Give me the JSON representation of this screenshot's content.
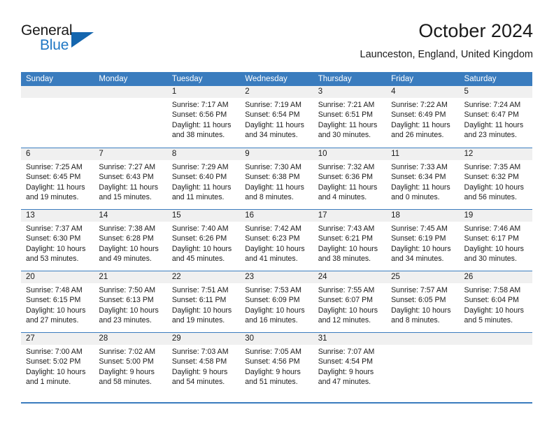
{
  "logo": {
    "word1": "General",
    "word2": "Blue",
    "accent_color": "#1566ae"
  },
  "header": {
    "title": "October 2024",
    "subtitle": "Launceston, England, United Kingdom"
  },
  "theme": {
    "header_blue": "#3a7cbe",
    "daynum_band": "#f0f0f0"
  },
  "weekdays": [
    "Sunday",
    "Monday",
    "Tuesday",
    "Wednesday",
    "Thursday",
    "Friday",
    "Saturday"
  ],
  "labels": {
    "sunrise": "Sunrise:",
    "sunset": "Sunset:",
    "daylight": "Daylight:"
  },
  "weeks": [
    [
      {
        "day": "",
        "sunrise": "",
        "sunset": "",
        "daylight1": "",
        "daylight2": ""
      },
      {
        "day": "",
        "sunrise": "",
        "sunset": "",
        "daylight1": "",
        "daylight2": ""
      },
      {
        "day": "1",
        "sunrise": "Sunrise: 7:17 AM",
        "sunset": "Sunset: 6:56 PM",
        "daylight1": "Daylight: 11 hours",
        "daylight2": "and 38 minutes."
      },
      {
        "day": "2",
        "sunrise": "Sunrise: 7:19 AM",
        "sunset": "Sunset: 6:54 PM",
        "daylight1": "Daylight: 11 hours",
        "daylight2": "and 34 minutes."
      },
      {
        "day": "3",
        "sunrise": "Sunrise: 7:21 AM",
        "sunset": "Sunset: 6:51 PM",
        "daylight1": "Daylight: 11 hours",
        "daylight2": "and 30 minutes."
      },
      {
        "day": "4",
        "sunrise": "Sunrise: 7:22 AM",
        "sunset": "Sunset: 6:49 PM",
        "daylight1": "Daylight: 11 hours",
        "daylight2": "and 26 minutes."
      },
      {
        "day": "5",
        "sunrise": "Sunrise: 7:24 AM",
        "sunset": "Sunset: 6:47 PM",
        "daylight1": "Daylight: 11 hours",
        "daylight2": "and 23 minutes."
      }
    ],
    [
      {
        "day": "6",
        "sunrise": "Sunrise: 7:25 AM",
        "sunset": "Sunset: 6:45 PM",
        "daylight1": "Daylight: 11 hours",
        "daylight2": "and 19 minutes."
      },
      {
        "day": "7",
        "sunrise": "Sunrise: 7:27 AM",
        "sunset": "Sunset: 6:43 PM",
        "daylight1": "Daylight: 11 hours",
        "daylight2": "and 15 minutes."
      },
      {
        "day": "8",
        "sunrise": "Sunrise: 7:29 AM",
        "sunset": "Sunset: 6:40 PM",
        "daylight1": "Daylight: 11 hours",
        "daylight2": "and 11 minutes."
      },
      {
        "day": "9",
        "sunrise": "Sunrise: 7:30 AM",
        "sunset": "Sunset: 6:38 PM",
        "daylight1": "Daylight: 11 hours",
        "daylight2": "and 8 minutes."
      },
      {
        "day": "10",
        "sunrise": "Sunrise: 7:32 AM",
        "sunset": "Sunset: 6:36 PM",
        "daylight1": "Daylight: 11 hours",
        "daylight2": "and 4 minutes."
      },
      {
        "day": "11",
        "sunrise": "Sunrise: 7:33 AM",
        "sunset": "Sunset: 6:34 PM",
        "daylight1": "Daylight: 11 hours",
        "daylight2": "and 0 minutes."
      },
      {
        "day": "12",
        "sunrise": "Sunrise: 7:35 AM",
        "sunset": "Sunset: 6:32 PM",
        "daylight1": "Daylight: 10 hours",
        "daylight2": "and 56 minutes."
      }
    ],
    [
      {
        "day": "13",
        "sunrise": "Sunrise: 7:37 AM",
        "sunset": "Sunset: 6:30 PM",
        "daylight1": "Daylight: 10 hours",
        "daylight2": "and 53 minutes."
      },
      {
        "day": "14",
        "sunrise": "Sunrise: 7:38 AM",
        "sunset": "Sunset: 6:28 PM",
        "daylight1": "Daylight: 10 hours",
        "daylight2": "and 49 minutes."
      },
      {
        "day": "15",
        "sunrise": "Sunrise: 7:40 AM",
        "sunset": "Sunset: 6:26 PM",
        "daylight1": "Daylight: 10 hours",
        "daylight2": "and 45 minutes."
      },
      {
        "day": "16",
        "sunrise": "Sunrise: 7:42 AM",
        "sunset": "Sunset: 6:23 PM",
        "daylight1": "Daylight: 10 hours",
        "daylight2": "and 41 minutes."
      },
      {
        "day": "17",
        "sunrise": "Sunrise: 7:43 AM",
        "sunset": "Sunset: 6:21 PM",
        "daylight1": "Daylight: 10 hours",
        "daylight2": "and 38 minutes."
      },
      {
        "day": "18",
        "sunrise": "Sunrise: 7:45 AM",
        "sunset": "Sunset: 6:19 PM",
        "daylight1": "Daylight: 10 hours",
        "daylight2": "and 34 minutes."
      },
      {
        "day": "19",
        "sunrise": "Sunrise: 7:46 AM",
        "sunset": "Sunset: 6:17 PM",
        "daylight1": "Daylight: 10 hours",
        "daylight2": "and 30 minutes."
      }
    ],
    [
      {
        "day": "20",
        "sunrise": "Sunrise: 7:48 AM",
        "sunset": "Sunset: 6:15 PM",
        "daylight1": "Daylight: 10 hours",
        "daylight2": "and 27 minutes."
      },
      {
        "day": "21",
        "sunrise": "Sunrise: 7:50 AM",
        "sunset": "Sunset: 6:13 PM",
        "daylight1": "Daylight: 10 hours",
        "daylight2": "and 23 minutes."
      },
      {
        "day": "22",
        "sunrise": "Sunrise: 7:51 AM",
        "sunset": "Sunset: 6:11 PM",
        "daylight1": "Daylight: 10 hours",
        "daylight2": "and 19 minutes."
      },
      {
        "day": "23",
        "sunrise": "Sunrise: 7:53 AM",
        "sunset": "Sunset: 6:09 PM",
        "daylight1": "Daylight: 10 hours",
        "daylight2": "and 16 minutes."
      },
      {
        "day": "24",
        "sunrise": "Sunrise: 7:55 AM",
        "sunset": "Sunset: 6:07 PM",
        "daylight1": "Daylight: 10 hours",
        "daylight2": "and 12 minutes."
      },
      {
        "day": "25",
        "sunrise": "Sunrise: 7:57 AM",
        "sunset": "Sunset: 6:05 PM",
        "daylight1": "Daylight: 10 hours",
        "daylight2": "and 8 minutes."
      },
      {
        "day": "26",
        "sunrise": "Sunrise: 7:58 AM",
        "sunset": "Sunset: 6:04 PM",
        "daylight1": "Daylight: 10 hours",
        "daylight2": "and 5 minutes."
      }
    ],
    [
      {
        "day": "27",
        "sunrise": "Sunrise: 7:00 AM",
        "sunset": "Sunset: 5:02 PM",
        "daylight1": "Daylight: 10 hours",
        "daylight2": "and 1 minute."
      },
      {
        "day": "28",
        "sunrise": "Sunrise: 7:02 AM",
        "sunset": "Sunset: 5:00 PM",
        "daylight1": "Daylight: 9 hours",
        "daylight2": "and 58 minutes."
      },
      {
        "day": "29",
        "sunrise": "Sunrise: 7:03 AM",
        "sunset": "Sunset: 4:58 PM",
        "daylight1": "Daylight: 9 hours",
        "daylight2": "and 54 minutes."
      },
      {
        "day": "30",
        "sunrise": "Sunrise: 7:05 AM",
        "sunset": "Sunset: 4:56 PM",
        "daylight1": "Daylight: 9 hours",
        "daylight2": "and 51 minutes."
      },
      {
        "day": "31",
        "sunrise": "Sunrise: 7:07 AM",
        "sunset": "Sunset: 4:54 PM",
        "daylight1": "Daylight: 9 hours",
        "daylight2": "and 47 minutes."
      },
      {
        "day": "",
        "sunrise": "",
        "sunset": "",
        "daylight1": "",
        "daylight2": ""
      },
      {
        "day": "",
        "sunrise": "",
        "sunset": "",
        "daylight1": "",
        "daylight2": ""
      }
    ]
  ]
}
